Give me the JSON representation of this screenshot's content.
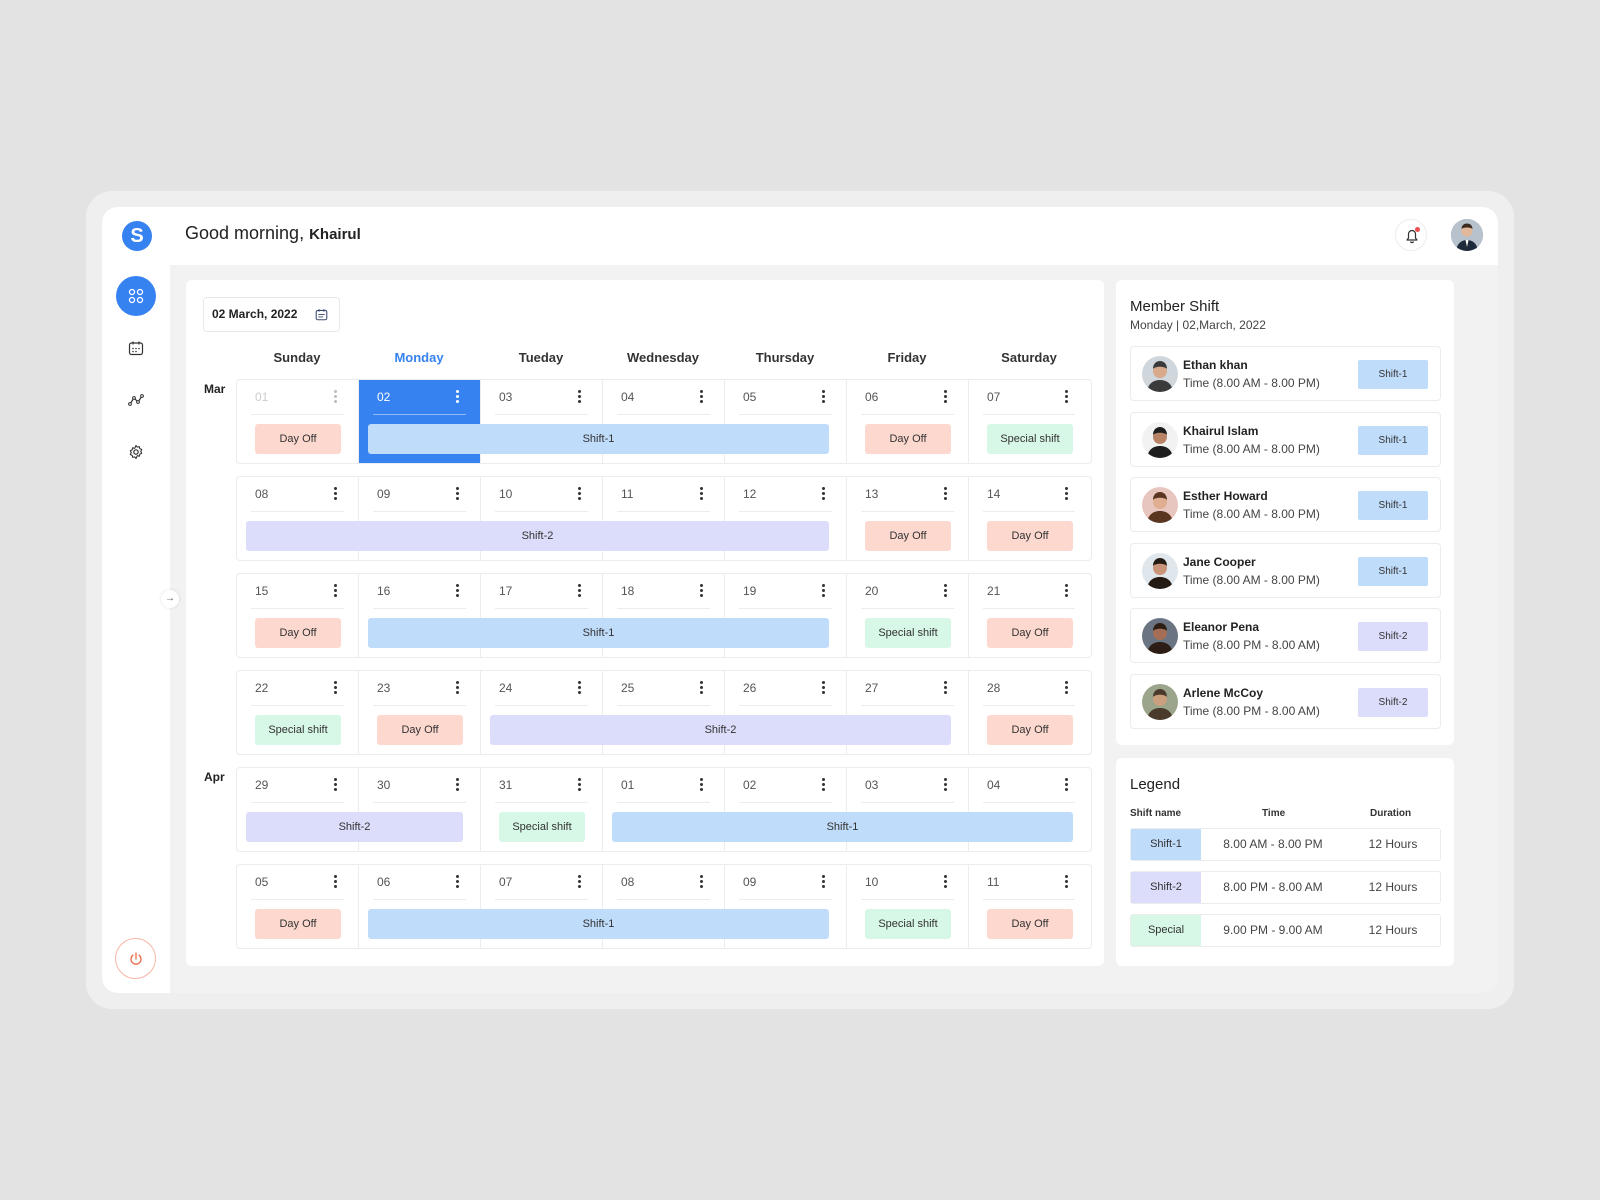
{
  "app": {
    "logo_letter": "S",
    "greeting": "Good morning,",
    "user_name": "Khairul"
  },
  "sidebar": {
    "items": [
      {
        "icon": "grid-icon",
        "active": true
      },
      {
        "icon": "calendar-icon",
        "active": false
      },
      {
        "icon": "analytics-icon",
        "active": false
      },
      {
        "icon": "gear-icon",
        "active": false
      }
    ],
    "logout_icon": "power-icon",
    "collapse_icon": "arrow-right-icon"
  },
  "calendar": {
    "date_label": "02 March, 2022",
    "days": [
      "Sunday",
      "Monday",
      "Tueday",
      "Wednesday",
      "Thursday",
      "Friday",
      "Saturday"
    ],
    "current_day_index": 1,
    "months": [
      "Mar",
      "Apr"
    ],
    "weeks": [
      {
        "dates": [
          "01",
          "02",
          "03",
          "04",
          "05",
          "06",
          "07"
        ],
        "events": [
          {
            "label": "Day Off",
            "type": "dayoff",
            "start": 0,
            "end": 0
          },
          {
            "label": "Shift-1",
            "type": "shift1",
            "start": 1,
            "end": 4
          },
          {
            "label": "Day Off",
            "type": "dayoff",
            "start": 5,
            "end": 5
          },
          {
            "label": "Special shift",
            "type": "special",
            "start": 6,
            "end": 6
          }
        ]
      },
      {
        "dates": [
          "08",
          "09",
          "10",
          "11",
          "12",
          "13",
          "14"
        ],
        "events": [
          {
            "label": "Shift-2",
            "type": "shift2",
            "start": 0,
            "end": 4
          },
          {
            "label": "Day Off",
            "type": "dayoff",
            "start": 5,
            "end": 5
          },
          {
            "label": "Day Off",
            "type": "dayoff",
            "start": 6,
            "end": 6
          }
        ]
      },
      {
        "dates": [
          "15",
          "16",
          "17",
          "18",
          "19",
          "20",
          "21"
        ],
        "events": [
          {
            "label": "Day Off",
            "type": "dayoff",
            "start": 0,
            "end": 0
          },
          {
            "label": "Shift-1",
            "type": "shift1",
            "start": 1,
            "end": 4
          },
          {
            "label": "Special shift",
            "type": "special",
            "start": 5,
            "end": 5
          },
          {
            "label": "Day Off",
            "type": "dayoff",
            "start": 6,
            "end": 6
          }
        ]
      },
      {
        "dates": [
          "22",
          "23",
          "24",
          "25",
          "26",
          "27",
          "28"
        ],
        "events": [
          {
            "label": "Special shift",
            "type": "special",
            "start": 0,
            "end": 0
          },
          {
            "label": "Day Off",
            "type": "dayoff",
            "start": 1,
            "end": 1
          },
          {
            "label": "Shift-2",
            "type": "shift2",
            "start": 2,
            "end": 5
          },
          {
            "label": "Day Off",
            "type": "dayoff",
            "start": 6,
            "end": 6
          }
        ]
      },
      {
        "dates": [
          "29",
          "30",
          "31",
          "01",
          "02",
          "03",
          "04"
        ],
        "events": [
          {
            "label": "Shift-2",
            "type": "shift2",
            "start": 0,
            "end": 1
          },
          {
            "label": "Special shift",
            "type": "special",
            "start": 2,
            "end": 2
          },
          {
            "label": "Shift-1",
            "type": "shift1",
            "start": 3,
            "end": 6
          }
        ]
      },
      {
        "dates": [
          "05",
          "06",
          "07",
          "08",
          "09",
          "10",
          "11"
        ],
        "events": [
          {
            "label": "Day Off",
            "type": "dayoff",
            "start": 0,
            "end": 0
          },
          {
            "label": "Shift-1",
            "type": "shift1",
            "start": 1,
            "end": 4
          },
          {
            "label": "Special shift",
            "type": "special",
            "start": 5,
            "end": 5
          },
          {
            "label": "Day Off",
            "type": "dayoff",
            "start": 6,
            "end": 6
          }
        ]
      }
    ]
  },
  "member_shift": {
    "title": "Member Shift",
    "subtitle": "Monday | 02,March, 2022",
    "members": [
      {
        "name": "Ethan khan",
        "time": "Time (8.00 AM - 8.00 PM)",
        "shift": "Shift-1",
        "type": "shift1"
      },
      {
        "name": "Khairul Islam",
        "time": "Time (8.00 AM - 8.00 PM)",
        "shift": "Shift-1",
        "type": "shift1"
      },
      {
        "name": "Esther Howard",
        "time": "Time (8.00 AM - 8.00 PM)",
        "shift": "Shift-1",
        "type": "shift1"
      },
      {
        "name": "Jane Cooper",
        "time": "Time (8.00 AM - 8.00 PM)",
        "shift": "Shift-1",
        "type": "shift1"
      },
      {
        "name": "Eleanor Pena",
        "time": "Time (8.00 PM - 8.00 AM)",
        "shift": "Shift-2",
        "type": "shift2"
      },
      {
        "name": "Arlene McCoy",
        "time": "Time (8.00 PM - 8.00 AM)",
        "shift": "Shift-2",
        "type": "shift2"
      }
    ]
  },
  "legend": {
    "title": "Legend",
    "headers": {
      "name": "Shift name",
      "time": "Time",
      "duration": "Duration"
    },
    "rows": [
      {
        "name": "Shift-1",
        "time": "8.00 AM - 8.00 PM",
        "duration": "12 Hours",
        "type": "shift1"
      },
      {
        "name": "Shift-2",
        "time": "8.00 PM - 8.00 AM",
        "duration": "12 Hours",
        "type": "shift2"
      },
      {
        "name": "Special",
        "time": "9.00 PM - 9.00 AM",
        "duration": "12 Hours",
        "type": "special"
      }
    ]
  },
  "colors": {
    "accent": "#3582f0",
    "dayoff": "#fdd8cf",
    "special": "#d7f7e7",
    "shift1": "#bfdcfb",
    "shift2": "#dcdcfb"
  }
}
